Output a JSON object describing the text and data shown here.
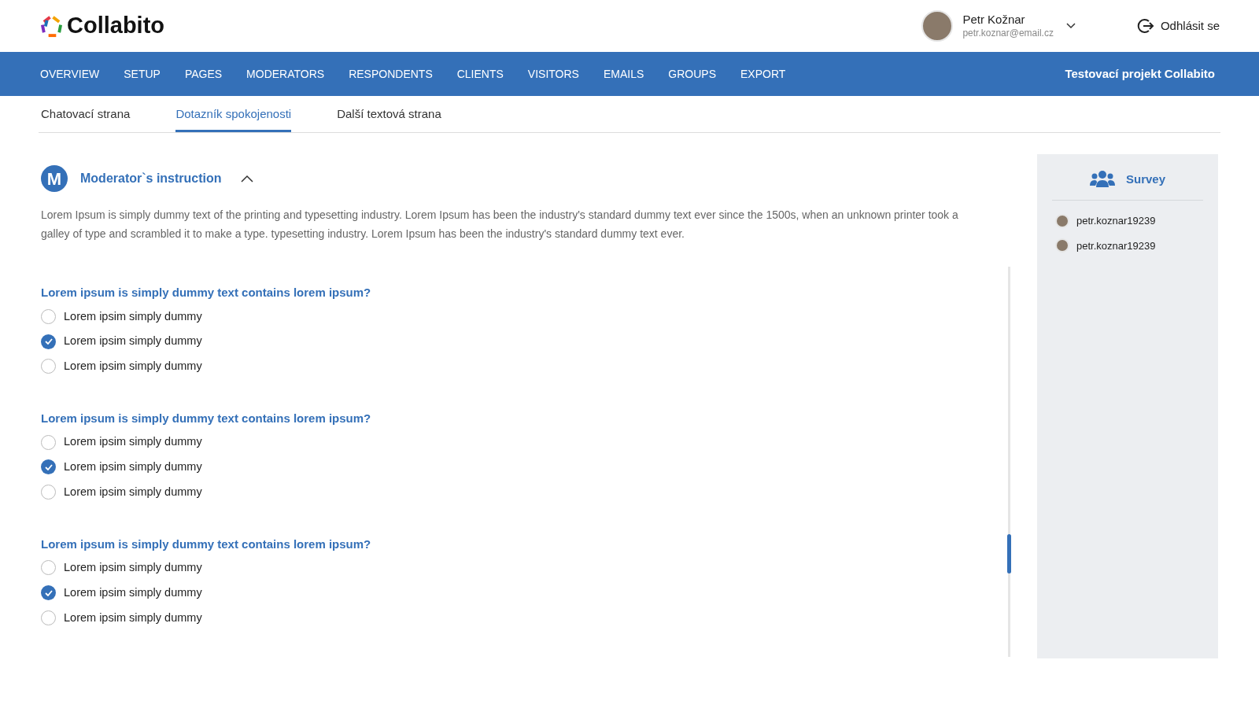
{
  "header": {
    "logo": "Collabito",
    "user": {
      "name": "Petr Kožnar",
      "email": "petr.koznar@email.cz"
    },
    "logout": "Odhlásit se"
  },
  "nav": {
    "items": [
      {
        "label": "OVERVIEW"
      },
      {
        "label": "SETUP"
      },
      {
        "label": "PAGES"
      },
      {
        "label": "MODERATORS"
      },
      {
        "label": "RESPONDENTS"
      },
      {
        "label": "CLIENTS"
      },
      {
        "label": "VISITORS"
      },
      {
        "label": "EMAILS"
      },
      {
        "label": "GROUPS"
      },
      {
        "label": "EXPORT"
      }
    ],
    "project": "Testovací projekt Collabito"
  },
  "tabs": [
    {
      "label": "Chatovací strana",
      "selected": false
    },
    {
      "label": "Dotazník spokojenosti",
      "selected": true
    },
    {
      "label": "Další textová strana",
      "selected": false
    }
  ],
  "instruction": {
    "badge": "M",
    "title": "Moderator`s instruction",
    "expanded": true,
    "text": "Lorem Ipsum is simply dummy text of the printing and typesetting industry. Lorem Ipsum has been the industry's standard dummy text ever since the 1500s, when an unknown printer took a galley of type and scrambled it to make a type. typesetting industry. Lorem Ipsum has been the industry's standard dummy text ever."
  },
  "questions": [
    {
      "question": "Lorem ipsum is simply dummy text contains lorem ipsum?",
      "options": [
        {
          "label": "Lorem ipsim simply dummy",
          "selected": false
        },
        {
          "label": "Lorem ipsim simply dummy",
          "selected": true
        },
        {
          "label": "Lorem ipsim simply dummy",
          "selected": false
        }
      ]
    },
    {
      "question": "Lorem ipsum is simply dummy text contains lorem ipsum?",
      "options": [
        {
          "label": "Lorem ipsim simply dummy",
          "selected": false
        },
        {
          "label": "Lorem ipsim simply dummy",
          "selected": true
        },
        {
          "label": "Lorem ipsim simply dummy",
          "selected": false
        }
      ]
    },
    {
      "question": "Lorem ipsum is simply dummy text contains lorem ipsum?",
      "options": [
        {
          "label": "Lorem ipsim simply dummy",
          "selected": false
        },
        {
          "label": "Lorem ipsim simply dummy",
          "selected": true
        },
        {
          "label": "Lorem ipsim simply dummy",
          "selected": false
        }
      ]
    }
  ],
  "panel": {
    "title": "Survey",
    "participants": [
      {
        "name": "petr.koznar19239"
      },
      {
        "name": "petr.koznar19239"
      }
    ]
  }
}
